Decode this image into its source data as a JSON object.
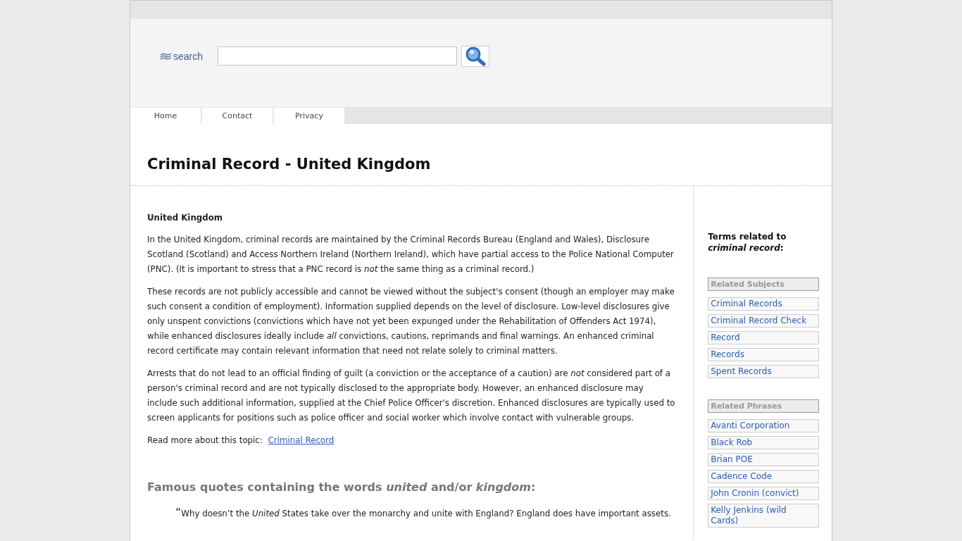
{
  "search": {
    "label": "search"
  },
  "nav": [
    "Home",
    "Contact",
    "Privacy"
  ],
  "title": "Criminal Record - United Kingdom",
  "article": {
    "heading": "United Kingdom",
    "paragraphs": [
      "In the United Kingdom, criminal records are maintained by the Criminal Records Bureau (England and Wales), Disclosure Scotland (Scotland) and Access Northern Ireland (Northern Ireland), which have partial access to the Police National Computer (PNC). (It is important to stress that a PNC record is *not* the same thing as a criminal record.)",
      "These records are not publicly accessible and cannot be viewed without the subject's consent (though an employer may make such consent a condition of employment). Information supplied depends on the level of disclosure. Low-level disclosures give only unspent convictions (convictions which have not yet been expunged under the Rehabilitation of Offenders Act 1974), while enhanced disclosures ideally include *all* convictions, cautions, reprimands and final warnings. An enhanced criminal record certificate may contain relevant information that need not relate solely to criminal matters.",
      "Arrests that do not lead to an official finding of guilt (a conviction or the acceptance of a caution) are *not* considered part of a person's criminal record and are not typically disclosed to the appropriate body. However, an enhanced disclosure may include such additional information, supplied at the Chief Police Officer's discretion. Enhanced disclosures are typically used to screen applicants for positions such as police officer and social worker which involve contact with vulnerable groups."
    ],
    "read_more": {
      "label": "Read more about this topic:",
      "link": "Criminal Record"
    }
  },
  "quotes": {
    "heading": "Famous quotes containing the words *united* and/or *kingdom*:",
    "mark": "“",
    "items": [
      "Why doesn’t the *United* States take over the monarchy and unite with England? England does have important assets."
    ]
  },
  "sidebar": {
    "heading": "Terms related to *criminal record*:",
    "sections": [
      {
        "title": "Related Subjects",
        "items": [
          "Criminal Records",
          "Criminal Record Check",
          "Record",
          "Records",
          "Spent Records"
        ]
      },
      {
        "title": "Related Phrases",
        "items": [
          "Avanti Corporation",
          "Black Rob",
          "Brian POE",
          "Cadence Code",
          "John Cronin (convict)",
          "Kelly Jenkins (wild Cards)"
        ]
      }
    ]
  }
}
